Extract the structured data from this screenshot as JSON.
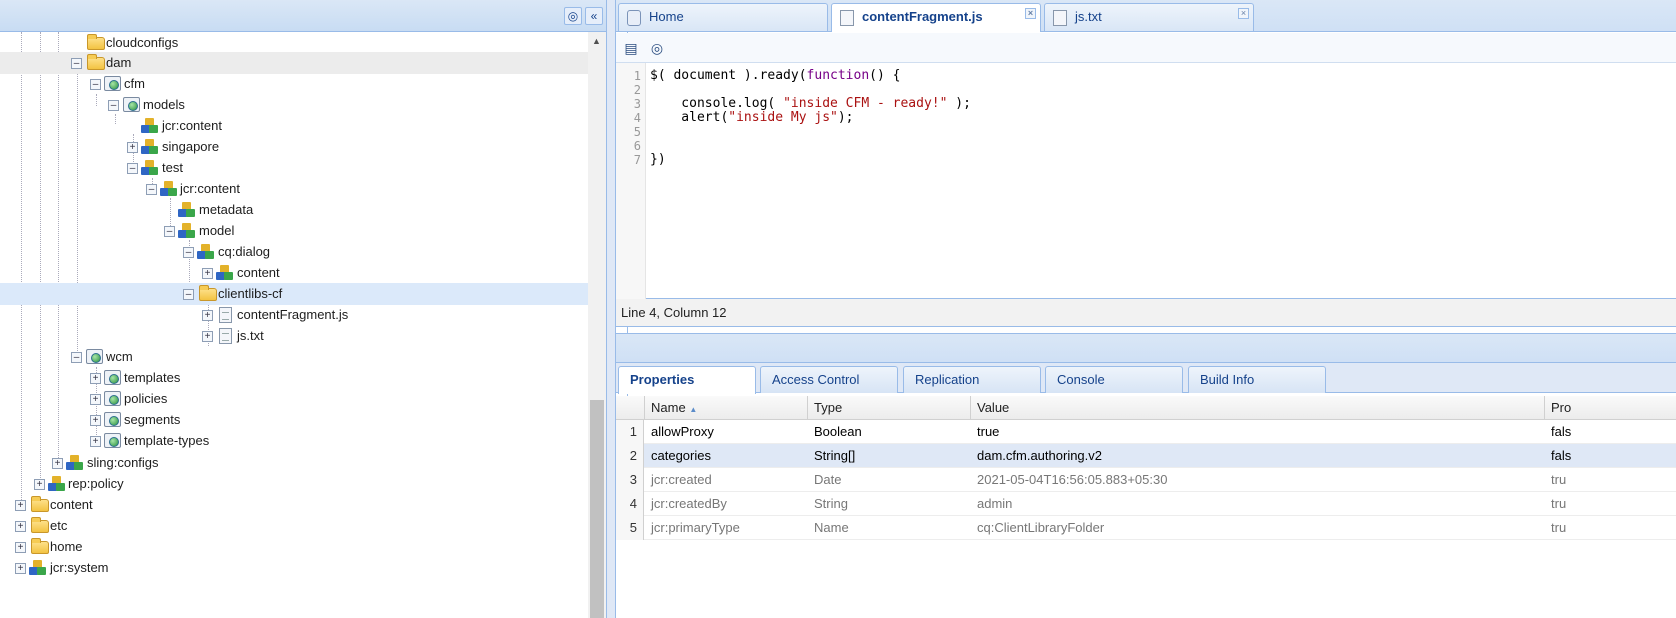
{
  "tree": {
    "items": [
      {
        "label": "cloudconfigs",
        "icon": "folder-icon"
      },
      {
        "label": "dam",
        "icon": "folder-icon"
      },
      {
        "label": "cfm",
        "icon": "node-icon"
      },
      {
        "label": "models",
        "icon": "node-icon"
      },
      {
        "label": "jcr:content",
        "icon": "cubes-icon"
      },
      {
        "label": "singapore",
        "icon": "cubes-icon"
      },
      {
        "label": "test",
        "icon": "cubes-icon"
      },
      {
        "label": "jcr:content",
        "icon": "cubes-icon"
      },
      {
        "label": "metadata",
        "icon": "cubes-icon"
      },
      {
        "label": "model",
        "icon": "cubes-icon"
      },
      {
        "label": "cq:dialog",
        "icon": "cubes-icon"
      },
      {
        "label": "content",
        "icon": "cubes-icon"
      },
      {
        "label": "clientlibs-cf",
        "icon": "folder-icon"
      },
      {
        "label": "contentFragment.js",
        "icon": "file-icon"
      },
      {
        "label": "js.txt",
        "icon": "file-icon"
      },
      {
        "label": "wcm",
        "icon": "node-icon"
      },
      {
        "label": "templates",
        "icon": "node-icon"
      },
      {
        "label": "policies",
        "icon": "node-icon"
      },
      {
        "label": "segments",
        "icon": "node-icon"
      },
      {
        "label": "template-types",
        "icon": "node-icon"
      },
      {
        "label": "sling:configs",
        "icon": "cubes-icon"
      },
      {
        "label": "rep:policy",
        "icon": "cubes-icon"
      },
      {
        "label": "content",
        "icon": "folder-icon"
      },
      {
        "label": "etc",
        "icon": "folder-icon"
      },
      {
        "label": "home",
        "icon": "folder-icon"
      },
      {
        "label": "jcr:system",
        "icon": "cubes-icon"
      }
    ]
  },
  "tabs": [
    {
      "label": "Home"
    },
    {
      "label": "contentFragment.js"
    },
    {
      "label": "js.txt"
    }
  ],
  "editor": {
    "line_numbers": [
      "1",
      "2",
      "3",
      "4",
      "5",
      "6",
      "7"
    ],
    "lines": [
      "$( document ).ready(function() {",
      "",
      "    console.log( \"inside CFM - ready!\" );",
      "    alert(\"inside My js\");",
      "",
      "",
      "})"
    ],
    "status": "Line 4, Column 12"
  },
  "properties": {
    "tabs": [
      "Properties",
      "Access Control",
      "Replication",
      "Console",
      "Build Info"
    ],
    "columns": [
      "Name",
      "Type",
      "Value",
      "Pro"
    ],
    "rows": [
      {
        "num": "1",
        "name": "allowProxy",
        "type": "Boolean",
        "value": "true",
        "prot": "fals"
      },
      {
        "num": "2",
        "name": "categories",
        "type": "String[]",
        "value": "dam.cfm.authoring.v2",
        "prot": "fals"
      },
      {
        "num": "3",
        "name": "jcr:created",
        "type": "Date",
        "value": "2021-05-04T16:56:05.883+05:30",
        "prot": "tru"
      },
      {
        "num": "4",
        "name": "jcr:createdBy",
        "type": "String",
        "value": "admin",
        "prot": "tru"
      },
      {
        "num": "5",
        "name": "jcr:primaryType",
        "type": "Name",
        "value": "cq:ClientLibraryFolder",
        "prot": "tru"
      }
    ]
  },
  "colors": {
    "accent": "#15428b",
    "panel_border": "#99bbe8",
    "selected_row": "#dbe9fa"
  }
}
